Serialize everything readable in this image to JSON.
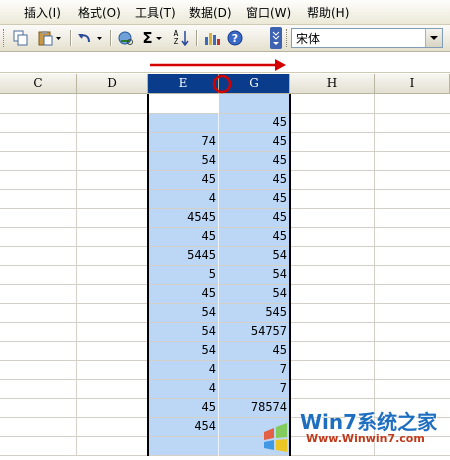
{
  "menubar": {
    "items": [
      "插入(I)",
      "格式(O)",
      "工具(T)",
      "数据(D)",
      "窗口(W)",
      "帮助(H)"
    ]
  },
  "toolbar": {
    "font_name": "宋体",
    "icons": [
      "copy-icon",
      "paste-icon",
      "undo-icon",
      "hyperlink-icon",
      "autosum-icon",
      "sort-icon",
      "chart-icon",
      "help-icon",
      "toolbar-options-icon",
      "dropdown-arrow-icon"
    ],
    "autosum_symbol": "Σ",
    "sort_label": "AZ",
    "help_symbol": "?"
  },
  "columns": [
    "C",
    "D",
    "E",
    "G",
    "H",
    "I"
  ],
  "selected_columns": [
    "E",
    "G"
  ],
  "rows": [
    {
      "e": "",
      "g": ""
    },
    {
      "e": "",
      "g": "45"
    },
    {
      "e": "74",
      "g": "45"
    },
    {
      "e": "54",
      "g": "45"
    },
    {
      "e": "45",
      "g": "45"
    },
    {
      "e": "4",
      "g": "45"
    },
    {
      "e": "4545",
      "g": "45"
    },
    {
      "e": "45",
      "g": "45"
    },
    {
      "e": "5445",
      "g": "54"
    },
    {
      "e": "5",
      "g": "54"
    },
    {
      "e": "45",
      "g": "54"
    },
    {
      "e": "54",
      "g": "545"
    },
    {
      "e": "54",
      "g": "54757"
    },
    {
      "e": "54",
      "g": "45"
    },
    {
      "e": "4",
      "g": "7"
    },
    {
      "e": "4",
      "g": "7"
    },
    {
      "e": "45",
      "g": "78574"
    },
    {
      "e": "454",
      "g": ""
    },
    {
      "e": "",
      "g": ""
    }
  ],
  "annotations": {
    "arrow_color": "#d40000",
    "circle_color": "#d40000"
  },
  "watermark": {
    "brand": "Win7系统之家",
    "url": "Www.Winwin7.com"
  }
}
